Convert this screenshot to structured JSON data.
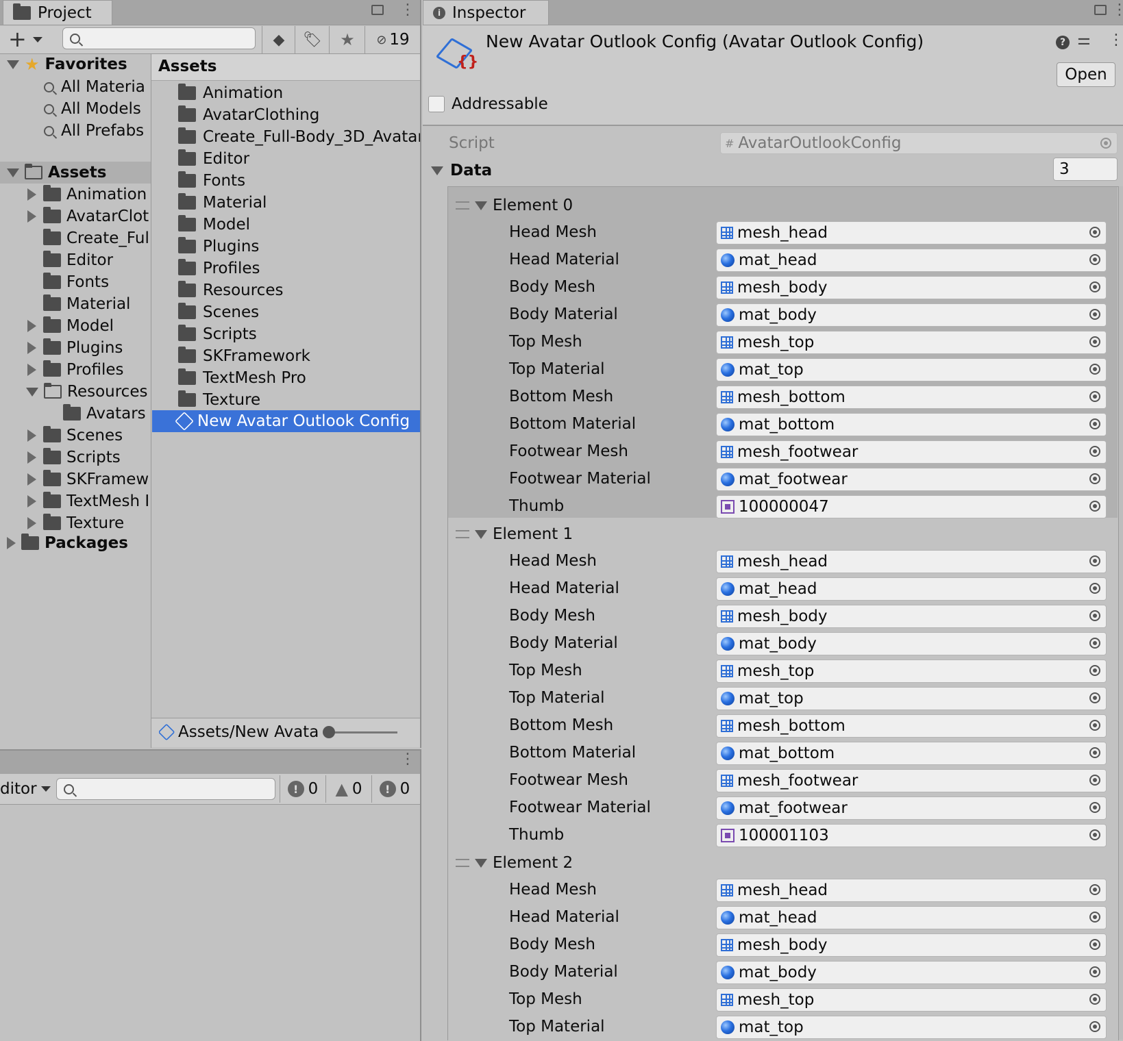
{
  "project_panel": {
    "tab_label": "Project",
    "add_label": "+",
    "hidden_count": "19",
    "favorites": {
      "label": "Favorites",
      "items": [
        "All Materia",
        "All Models",
        "All Prefabs"
      ]
    },
    "assets_label": "Assets",
    "tree": [
      "Animation",
      "AvatarClot",
      "Create_Ful",
      "Editor",
      "Fonts",
      "Material",
      "Model",
      "Plugins",
      "Profiles",
      "Resources",
      "Avatars",
      "Scenes",
      "Scripts",
      "SKFramew",
      "TextMesh I",
      "Texture"
    ],
    "packages_label": "Packages",
    "list_header": "Assets",
    "list_items": [
      "Animation",
      "AvatarClothing",
      "Create_Full-Body_3D_Avatar",
      "Editor",
      "Fonts",
      "Material",
      "Model",
      "Plugins",
      "Profiles",
      "Resources",
      "Scenes",
      "Scripts",
      "SKFramework",
      "TextMesh Pro",
      "Texture"
    ],
    "selected_item": "New Avatar Outlook Config",
    "footer_path": "Assets/New Avata"
  },
  "console_panel": {
    "dropdown_label": "ditor",
    "error_count": "0",
    "warning_count": "0",
    "info_count": "0"
  },
  "inspector": {
    "tab_label": "Inspector",
    "title": "New Avatar Outlook Config (Avatar Outlook Config)",
    "open_label": "Open",
    "addressable_label": "Addressable",
    "script_label": "Script",
    "script_value": "AvatarOutlookConfig",
    "data_label": "Data",
    "data_size": "3",
    "field_labels": [
      "Head Mesh",
      "Head Material",
      "Body Mesh",
      "Body Material",
      "Top Mesh",
      "Top Material",
      "Bottom Mesh",
      "Bottom Material",
      "Footwear Mesh",
      "Footwear Material",
      "Thumb"
    ],
    "elements": [
      {
        "label": "Element 0",
        "values": [
          "mesh_head",
          "mat_head",
          "mesh_body",
          "mat_body",
          "mesh_top",
          "mat_top",
          "mesh_bottom",
          "mat_bottom",
          "mesh_footwear",
          "mat_footwear",
          "100000047"
        ]
      },
      {
        "label": "Element 1",
        "values": [
          "mesh_head",
          "mat_head",
          "mesh_body",
          "mat_body",
          "mesh_top",
          "mat_top",
          "mesh_bottom",
          "mat_bottom",
          "mesh_footwear",
          "mat_footwear",
          "100001103"
        ]
      },
      {
        "label": "Element 2",
        "values": [
          "mesh_head",
          "mat_head",
          "mesh_body",
          "mat_body",
          "mesh_top",
          "mat_top"
        ]
      }
    ],
    "field_icons": [
      "mesh-icon",
      "material-icon",
      "mesh-icon",
      "material-icon",
      "mesh-icon",
      "material-icon",
      "mesh-icon",
      "material-icon",
      "mesh-icon",
      "material-icon",
      "texture-icon"
    ]
  },
  "colors": {
    "selection": "#3a72d8",
    "element0_bg": "#b1b1b1",
    "panel_bg": "#c2c2c2"
  }
}
